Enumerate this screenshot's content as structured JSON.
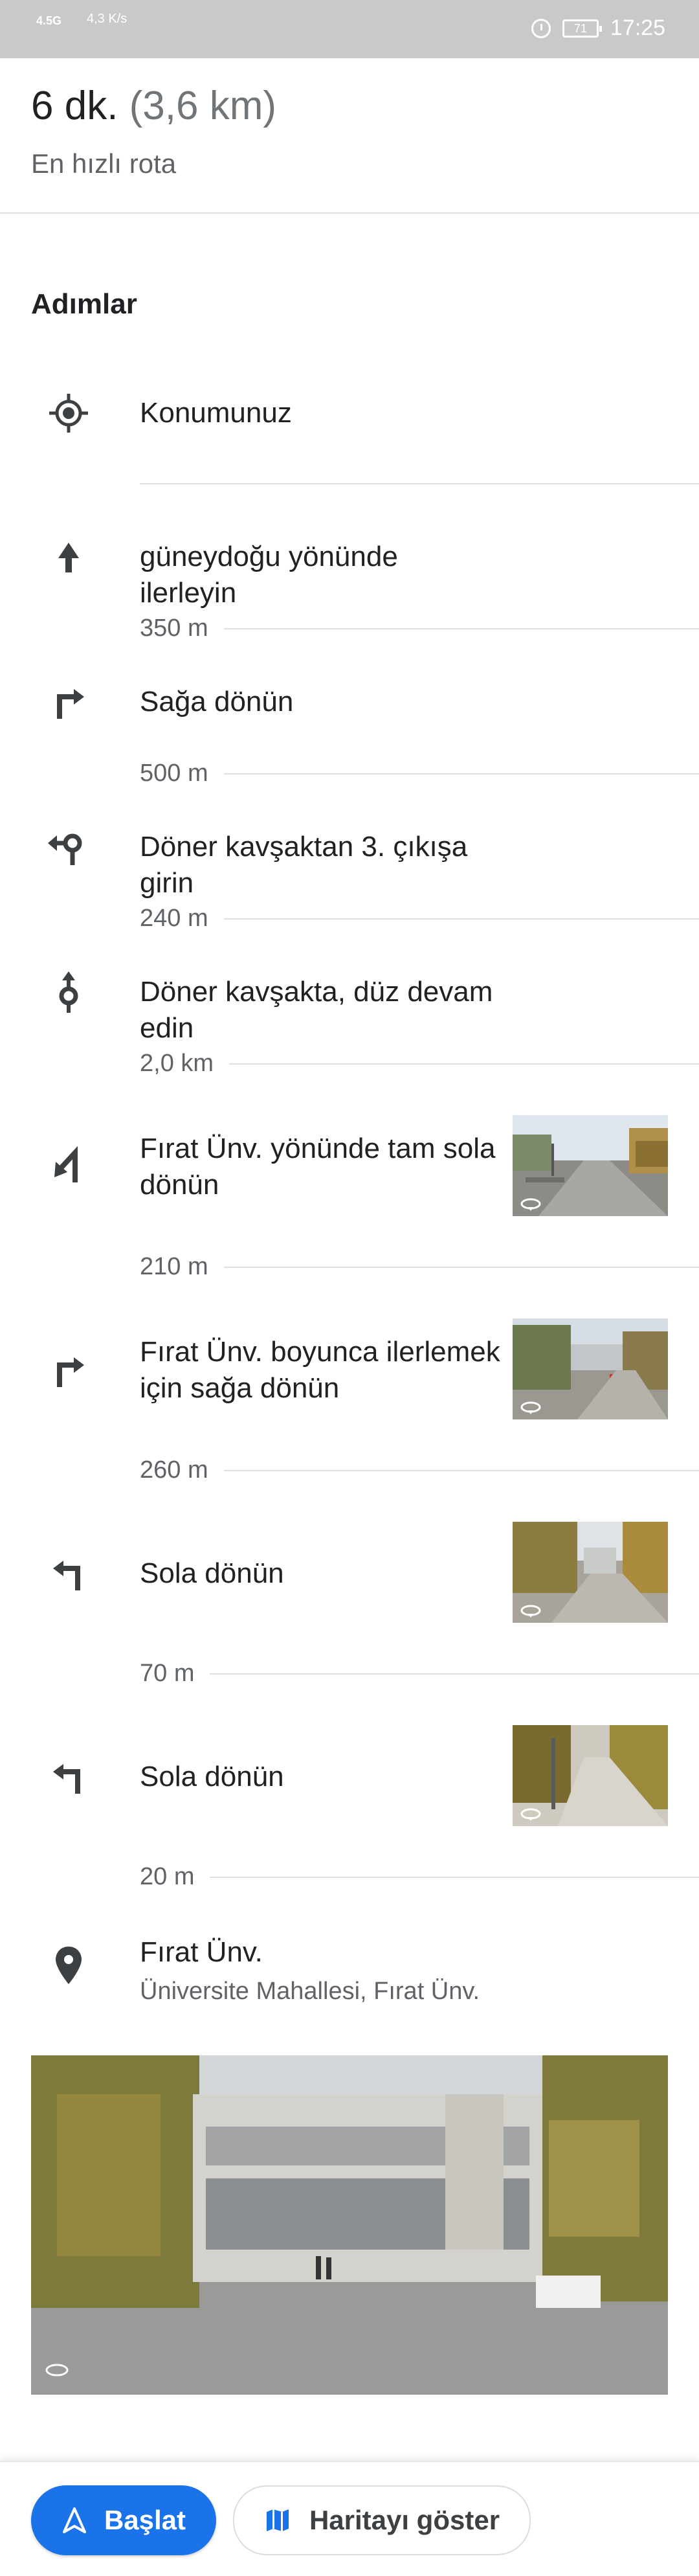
{
  "status_bar": {
    "network": "4.5G",
    "speed": "4,3 K/s",
    "battery": "71",
    "time": "17:25"
  },
  "route": {
    "duration": "6 dk.",
    "distance": "(3,6 km)",
    "subtitle": "En hızlı rota"
  },
  "section_title": "Adımlar",
  "origin": {
    "label": "Konumunuz",
    "icon": "my-location-icon"
  },
  "steps": [
    {
      "text": "güneydoğu yönünde ilerleyin",
      "distance": "350 m",
      "icon": "arrow-up-icon"
    },
    {
      "text": "Sağa dönün",
      "distance": "500 m",
      "icon": "turn-right-icon"
    },
    {
      "text": "Döner kavşaktan 3. çıkışa girin",
      "distance": "240 m",
      "icon": "roundabout-exit-icon"
    },
    {
      "text": "Döner kavşakta, düz devam edin",
      "distance": "2,0 km",
      "icon": "roundabout-straight-icon"
    },
    {
      "text": "Fırat Ünv. yönünde tam sola dönün",
      "distance": "210 m",
      "icon": "sharp-left-icon"
    },
    {
      "text": "Fırat Ünv. boyunca ilerlemek için sağa dönün",
      "distance": "260 m",
      "icon": "turn-right-icon"
    },
    {
      "text": "Sola dönün",
      "distance": "70 m",
      "icon": "turn-left-icon"
    },
    {
      "text": "Sola dönün",
      "distance": "20 m",
      "icon": "turn-left-icon"
    }
  ],
  "destination": {
    "title": "Fırat Ünv.",
    "subtitle": "Üniversite Mahallesi, Fırat Ünv.",
    "icon": "place-pin-icon"
  },
  "buttons": {
    "start": "Başlat",
    "show_map": "Haritayı göster"
  },
  "colors": {
    "accent": "#1a73e8",
    "text": "#202124",
    "secondary_text": "#5f6368",
    "divider": "#e0e0e0"
  }
}
